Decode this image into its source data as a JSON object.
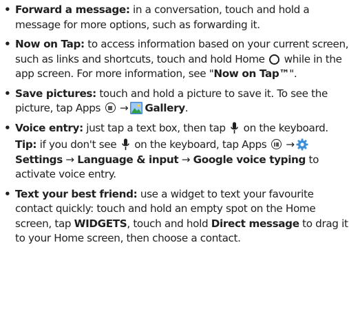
{
  "bullet": "•",
  "arrow": "→",
  "items": {
    "forward": {
      "title": "Forward a message:",
      "text": " in a conversation, touch and hold a message for more options, such as forwarding it."
    },
    "now_on_tap": {
      "title": "Now on Tap:",
      "text_a": " to access information based on your current screen, such as links and shortcuts, touch and hold Home ",
      "text_b": " while in the app screen. For more information, see \"",
      "link": "Now on Tap™",
      "text_c": "\"."
    },
    "save_pictures": {
      "title": "Save pictures:",
      "text_a": " touch and hold a picture to save it. To see the picture, tap Apps ",
      "app_label": "Gallery",
      "text_b": "."
    },
    "voice_entry": {
      "title": "Voice entry:",
      "text_a": " just tap a text box, then tap ",
      "text_b": " on the keyboard."
    },
    "tip": {
      "title": "Tip:",
      "text_a": " if you don't see ",
      "text_b": " on the keyboard, tap Apps ",
      "settings": "Settings",
      "language": "Language & input",
      "google_voice": "Google voice typing",
      "text_c": " to activate voice entry."
    },
    "text_friend": {
      "title": "Text your best friend:",
      "text_a": " use a widget to text your favourite contact quickly: touch and hold an empty spot on the Home screen, tap ",
      "widgets": "WIDGETS",
      "text_b": ", touch and hold ",
      "direct_message": "Direct message",
      "text_c": " to drag it to your Home screen, then choose a contact."
    }
  },
  "icons": {
    "home": "home-circle-icon",
    "apps": "apps-grid-icon",
    "gallery": "gallery-icon",
    "microphone": "microphone-icon",
    "settings": "settings-gear-icon"
  },
  "colors": {
    "text": "#202020",
    "gallery_green": "#2e9e44",
    "gallery_blue": "#4c86d6",
    "gear_blue": "#3a8fd9"
  }
}
